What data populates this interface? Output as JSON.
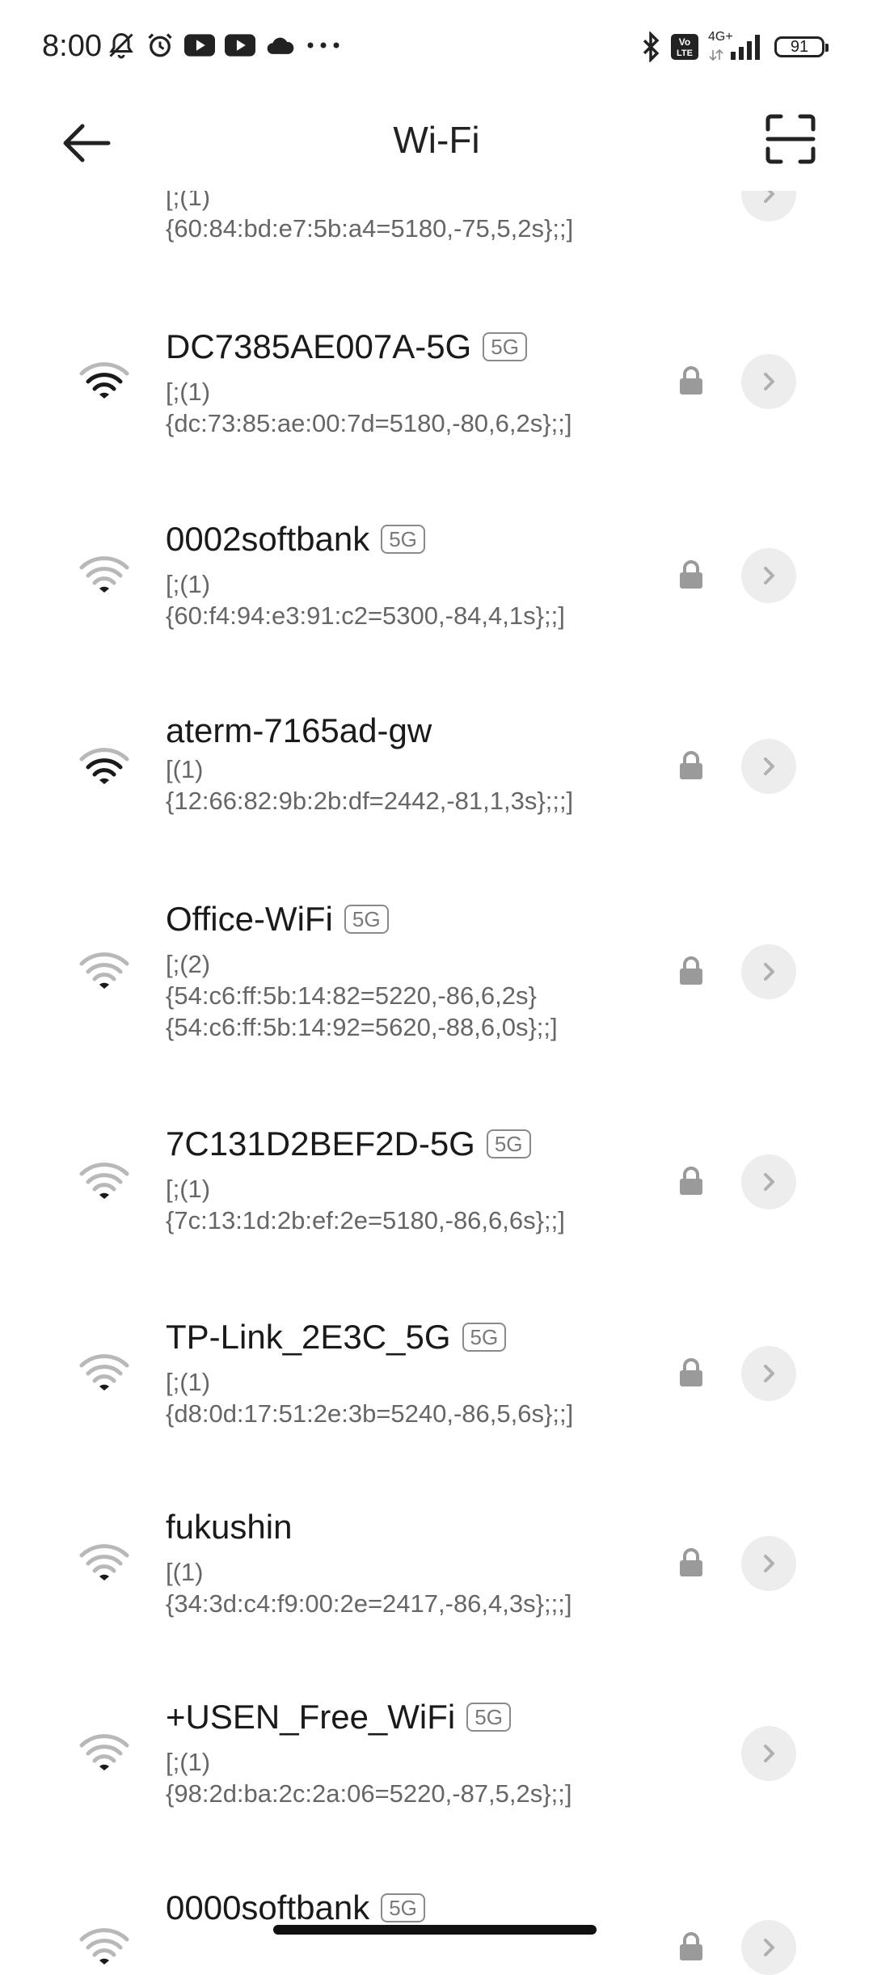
{
  "status_bar": {
    "time": "8:00",
    "left_icons": [
      "mute-bell-icon",
      "alarm-icon",
      "youtube-icon",
      "youtube-icon",
      "cloud-icon",
      "more-dots-icon"
    ],
    "right_icons": [
      "bluetooth-icon",
      "volte-icon",
      "signal-4g-icon",
      "battery-icon"
    ],
    "network_type": "4G+",
    "volte_label": "Vo\nLTE",
    "battery": "91"
  },
  "header": {
    "title": "Wi-Fi",
    "back_icon": "arrow-left-icon",
    "scan_icon": "scan-qr-icon"
  },
  "networks": [
    {
      "name": "",
      "badge": "",
      "detail": "[;(1)\n{60:84:bd:e7:5b:a4=5180,-75,5,2s};;]",
      "signal": "strong",
      "locked": false,
      "partial_top": true
    },
    {
      "name": "DC7385AE007A-5G",
      "badge": "5G",
      "detail": "[;(1)\n{dc:73:85:ae:00:7d=5180,-80,6,2s};;]",
      "signal": "strong",
      "locked": true
    },
    {
      "name": "0002softbank",
      "badge": "5G",
      "detail": "[;(1)\n{60:f4:94:e3:91:c2=5300,-84,4,1s};;]",
      "signal": "weak",
      "locked": true
    },
    {
      "name": "aterm-7165ad-gw",
      "badge": "",
      "detail": "[(1)\n{12:66:82:9b:2b:df=2442,-81,1,3s};;;]",
      "signal": "strong",
      "locked": true
    },
    {
      "name": "Office-WiFi",
      "badge": "5G",
      "detail": "[;(2)\n{54:c6:ff:5b:14:82=5220,-86,6,2s}\n{54:c6:ff:5b:14:92=5620,-88,6,0s};;]",
      "signal": "weak",
      "locked": true
    },
    {
      "name": "7C131D2BEF2D-5G",
      "badge": "5G",
      "detail": "[;(1)\n{7c:13:1d:2b:ef:2e=5180,-86,6,6s};;]",
      "signal": "weak",
      "locked": true
    },
    {
      "name": "TP-Link_2E3C_5G",
      "badge": "5G",
      "detail": "[;(1)\n{d8:0d:17:51:2e:3b=5240,-86,5,6s};;]",
      "signal": "weak",
      "locked": true
    },
    {
      "name": "fukushin",
      "badge": "",
      "detail": "[(1)\n{34:3d:c4:f9:00:2e=2417,-86,4,3s};;;]",
      "signal": "weak",
      "locked": true
    },
    {
      "name": "+USEN_Free_WiFi",
      "badge": "5G",
      "detail": "[;(1)\n{98:2d:ba:2c:2a:06=5220,-87,5,2s};;]",
      "signal": "weak",
      "locked": false
    },
    {
      "name": "0000softbank",
      "badge": "5G",
      "detail": "",
      "signal": "weak",
      "locked": true,
      "partial_bottom": true
    }
  ],
  "colors": {
    "strong_signal": "#1a1a1a",
    "weak_signal": "#b8b8b8",
    "lock": "#9a9a9a",
    "detail_button_bg": "#ededed",
    "chevron": "#b0b0b0"
  }
}
